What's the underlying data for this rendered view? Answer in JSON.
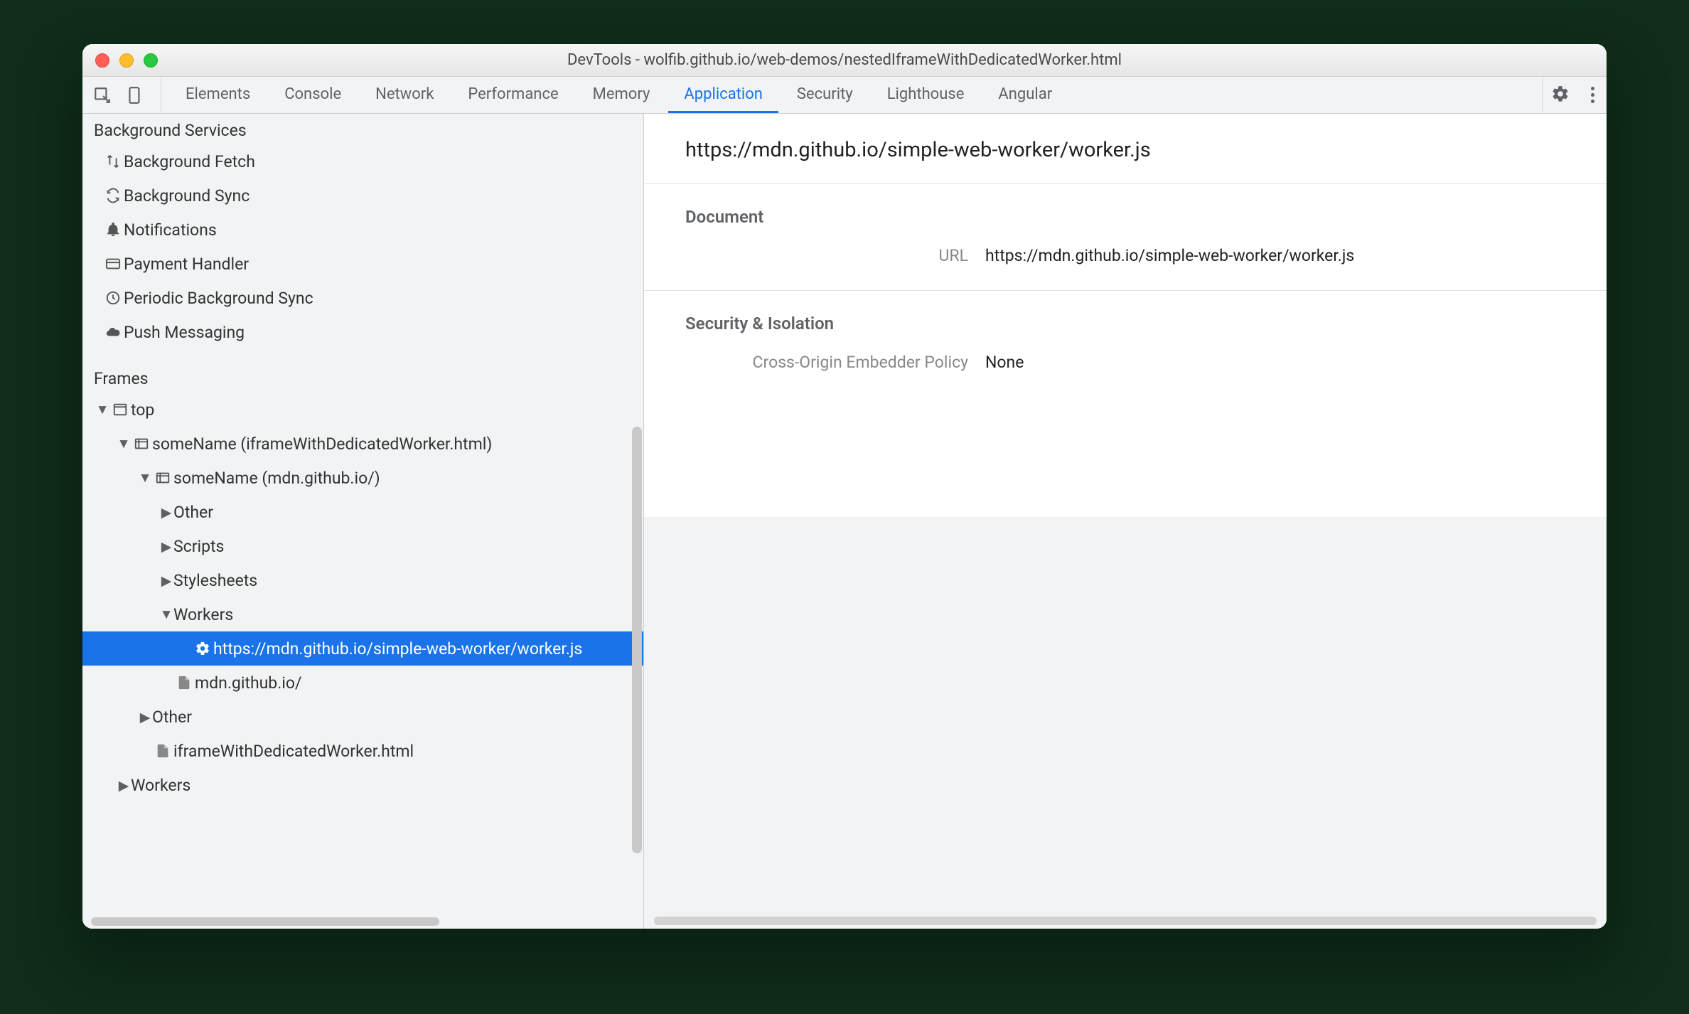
{
  "titlebar": {
    "title": "DevTools - wolfib.github.io/web-demos/nestedIframeWithDedicatedWorker.html"
  },
  "tabs": {
    "items": [
      {
        "label": "Elements",
        "active": false
      },
      {
        "label": "Console",
        "active": false
      },
      {
        "label": "Network",
        "active": false
      },
      {
        "label": "Performance",
        "active": false
      },
      {
        "label": "Memory",
        "active": false
      },
      {
        "label": "Application",
        "active": true
      },
      {
        "label": "Security",
        "active": false
      },
      {
        "label": "Lighthouse",
        "active": false
      },
      {
        "label": "Angular",
        "active": false
      }
    ]
  },
  "sidebar": {
    "sections": {
      "background": {
        "title": "Background Services",
        "items": [
          {
            "label": "Background Fetch",
            "icon": "updown"
          },
          {
            "label": "Background Sync",
            "icon": "sync"
          },
          {
            "label": "Notifications",
            "icon": "bell"
          },
          {
            "label": "Payment Handler",
            "icon": "card"
          },
          {
            "label": "Periodic Background Sync",
            "icon": "clock"
          },
          {
            "label": "Push Messaging",
            "icon": "cloud"
          }
        ]
      },
      "frames": {
        "title": "Frames",
        "tree": {
          "top_label": "top",
          "frame1_label": "someName (iframeWithDedicatedWorker.html)",
          "frame2_label": "someName (mdn.github.io/)",
          "other_label": "Other",
          "scripts_label": "Scripts",
          "stylesheets_label": "Stylesheets",
          "workers_label": "Workers",
          "worker_url": "https://mdn.github.io/simple-web-worker/worker.js",
          "doc_mdn_label": "mdn.github.io/",
          "other2_label": "Other",
          "doc_iframe_label": "iframeWithDedicatedWorker.html",
          "workers2_label": "Workers"
        }
      }
    }
  },
  "main": {
    "header_url": "https://mdn.github.io/simple-web-worker/worker.js",
    "blocks": {
      "document": {
        "title": "Document",
        "url_label": "URL",
        "url_value": "https://mdn.github.io/simple-web-worker/worker.js"
      },
      "security": {
        "title": "Security & Isolation",
        "coep_label": "Cross-Origin Embedder Policy",
        "coep_value": "None"
      }
    }
  }
}
